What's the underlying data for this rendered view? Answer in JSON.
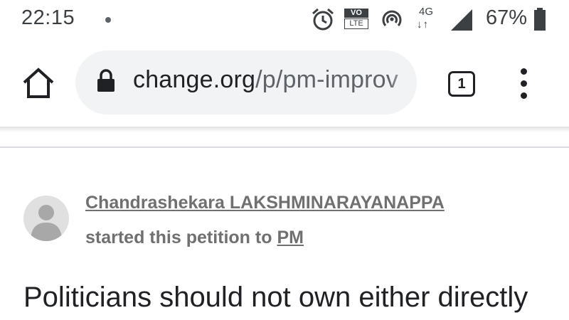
{
  "status_bar": {
    "time": "22:15",
    "volte_top": "VO",
    "volte_bottom": "LTE",
    "network_type": "4G",
    "network_arrows": "↓↑",
    "battery_percent": "67%"
  },
  "browser": {
    "url_domain": "change.org",
    "url_path": "/p/pm-improv",
    "tab_count": "1"
  },
  "petition": {
    "starter_name": "Chandrashekara LAKSHMINARAYANAPPA",
    "started_text": "started this petition to ",
    "target": "PM",
    "title": "Politicians should not own either directly"
  },
  "colors": {
    "text_primary": "#202124",
    "text_secondary": "#707070",
    "omnibox_bg": "#f1f3f4"
  },
  "icons": [
    "alarm-icon",
    "volte-icon",
    "hotspot-icon",
    "signal-icon",
    "battery-icon",
    "home-icon",
    "lock-icon",
    "tabs-icon",
    "more-vert-icon",
    "avatar-placeholder-icon"
  ]
}
